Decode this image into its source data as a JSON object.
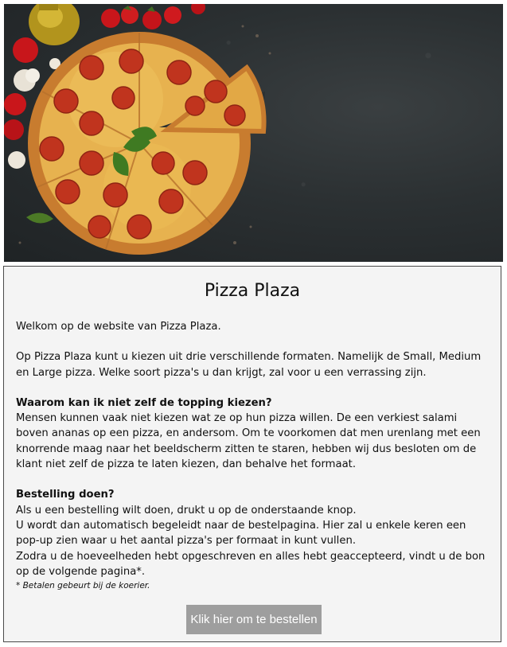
{
  "hero": {
    "image_alt": "Pepperoni pizza met basilicum, tomaten, knoflook en olijfolie op een donkere ondergrond"
  },
  "main": {
    "title": "Pizza Plaza",
    "welcome": "Welkom op de website van Pizza Plaza.",
    "intro": "Op Pizza Plaza kunt u kiezen uit drie verschillende formaten. Namelijk de Small, Medium en Large pizza. Welke soort pizza's u dan krijgt, zal voor u een verrassing zijn.",
    "topping_heading": "Waarom kan ik niet zelf de topping kiezen?",
    "topping_text": "Mensen kunnen vaak niet kiezen wat ze op hun pizza willen. De een verkiest salami boven ananas op een pizza, en andersom. Om te voorkomen dat men urenlang met een knorrende maag naar het beeldscherm zitten te staren, hebben wij dus besloten om de klant niet zelf de pizza te laten kiezen, dan behalve het formaat.",
    "order_heading": "Bestelling doen?",
    "order_line1": "Als u een bestelling wilt doen, drukt u op de onderstaande knop.",
    "order_line2": "U wordt dan automatisch begeleidt naar de bestelpagina. Hier zal u enkele keren een pop-up zien waar u het aantal pizza's per formaat in kunt vullen.",
    "order_line3": "Zodra u de hoeveelheden hebt opgeschreven en alles hebt geaccepteerd, vindt u de bon op de volgende pagina*.",
    "footnote": "* Betalen gebeurt bij de koerier.",
    "order_button": "Klik hier om te bestellen"
  },
  "colors": {
    "page_bg": "#f4f4f4",
    "button_bg": "#9e9e9e",
    "button_text": "#ffffff",
    "hero_bg": "#2b3032"
  }
}
